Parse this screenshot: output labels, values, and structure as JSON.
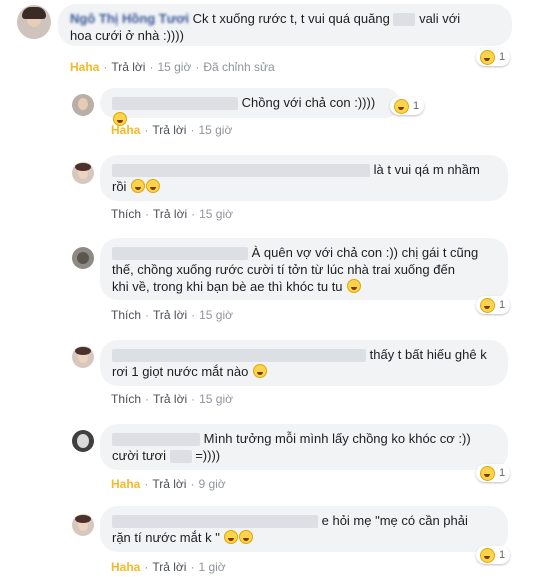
{
  "comments": [
    {
      "name": "Ngô Thị Hồng Tươi",
      "text": "Ck t xuống rước t, t vui quá quăng",
      "text2": "vali với",
      "line2": "hoa cưới ở nhà :))))",
      "reaction_count": "1",
      "reaction_label": "Haha",
      "reply": "Trả lời",
      "time": "15 giờ",
      "edited": "Đã chỉnh sửa"
    },
    {
      "text": "Chồng với chả con :))))",
      "reaction_count": "1",
      "reaction_label": "Haha",
      "reply": "Trả lời",
      "time": "15 giờ"
    },
    {
      "text": "là t vui qá m nhầm",
      "line2": "rồi",
      "reaction_label": "Thích",
      "reply": "Trả lời",
      "time": "15 giờ"
    },
    {
      "text": "À quên vợ với chả con :)) chị gái t cũng",
      "line2": "thế, chồng xuống rước cười tí tởn từ lúc nhà trai xuống đến",
      "line3": "khi về, trong khi bạn bè ae thì khóc tu tu",
      "reaction_count": "1",
      "reaction_label": "Thích",
      "reply": "Trả lời",
      "time": "15 giờ"
    },
    {
      "text": "thấy t bất hiếu ghê k",
      "line2": "rơi 1 giọt nước mắt nào",
      "reaction_label": "Thích",
      "reply": "Trả lời",
      "time": "15 giờ"
    },
    {
      "text": "Mình tưởng mỗi mình lấy chồng ko khóc cơ :))",
      "line2": "cười tươi",
      "line2b": "=))))",
      "reaction_count": "1",
      "reaction_label": "Haha",
      "reply": "Trả lời",
      "time": "9 giờ"
    },
    {
      "text": "e hỏi mẹ \"mẹ có cần phải",
      "line2": "rặn tí nước mắt k \"",
      "reaction_count": "1",
      "reaction_label": "Haha",
      "reply": "Trả lời",
      "time": "1 giờ"
    }
  ]
}
